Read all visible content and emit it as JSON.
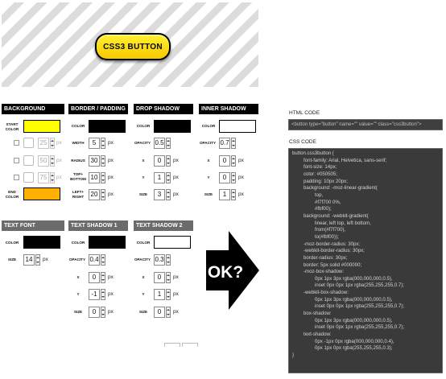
{
  "preview": {
    "button_text": "CSS3 BUTTON"
  },
  "panels": {
    "background": {
      "title": "BACKGROUND",
      "start_color_label": "START COLOR",
      "start_color": "#ffff00",
      "stops": [
        {
          "value": "25"
        },
        {
          "value": "50"
        },
        {
          "value": "75"
        }
      ],
      "end_color_label": "END COLOR",
      "end_color": "#ffb000"
    },
    "border": {
      "title": "BORDER / PADDING",
      "color_label": "COLOR",
      "color": "#000000",
      "width_label": "WIDTH",
      "width": "5",
      "radius_label": "RADIUS",
      "radius": "30",
      "topbottom_label": "TOP+ BOTTOM",
      "topbottom": "10",
      "leftright_label": "LEFT+ RIGHT",
      "leftright": "20"
    },
    "drop_shadow": {
      "title": "DROP SHADOW",
      "color_label": "COLOR",
      "color": "#000000",
      "opacity_label": "OPACITY",
      "opacity": "0.5",
      "x_label": "X",
      "x": "0",
      "y_label": "Y",
      "y": "1",
      "size_label": "SIZE",
      "size": "3"
    },
    "inner_shadow": {
      "title": "INNER SHADOW",
      "color_label": "COLOR",
      "color": "#ffffff",
      "opacity_label": "OPACITY",
      "opacity": "0.7",
      "x_label": "X",
      "x": "0",
      "y_label": "Y",
      "y": "0",
      "size_label": "SIZE",
      "size": "1"
    },
    "text_font": {
      "title": "TEXT FONT",
      "color_label": "COLOR",
      "color": "#000000",
      "size_label": "SIZE",
      "size": "14"
    },
    "text_shadow_1": {
      "title": "TEXT SHADOW 1",
      "color_label": "COLOR",
      "color": "#000000",
      "opacity_label": "OPACITY",
      "opacity": "0.4",
      "x_label": "X",
      "x": "0",
      "y_label": "Y",
      "y": "-1",
      "size_label": "SIZE",
      "size": "0"
    },
    "text_shadow_2": {
      "title": "TEXT SHADOW 2",
      "color_label": "COLOR",
      "color": "#ffffff",
      "opacity_label": "OPACITY",
      "opacity": "0.3",
      "x_label": "X",
      "x": "0",
      "y_label": "Y",
      "y": "1",
      "size_label": "SIZE",
      "size": "0"
    }
  },
  "unit": "px",
  "ok_badge": "OK?",
  "html_code": {
    "label": "HTML CODE",
    "value": "<button type=\"button\" name=\"\" value=\"\" class=\"css3button\">"
  },
  "css_code": {
    "label": "CSS CODE",
    "lines": [
      "button.css3button {",
      "\tfont-family: Arial, Helvetica, sans-serif;",
      "\tfont-size: 14px;",
      "\tcolor: #050505;",
      "\tpadding: 10px 20px;",
      "\tbackground: -moz-linear-gradient(",
      "\t\ttop,",
      "\t\t#f7f700 0%,",
      "\t\t#fbf00);",
      "\tbackground: -webkit-gradient(",
      "\t\tlinear, left top, left bottom,",
      "\t\tfrom(#f7f700),",
      "\t\tto(#fbf00));",
      "\t-moz-border-radius: 30px;",
      "\t-webkit-border-radius: 30px;",
      "\tborder-radius: 30px;",
      "\tborder: 5px solid #000000;",
      "\t-moz-box-shadow:",
      "\t\t0px 1px 3px rgba(000,000,000,0.5),",
      "\t\tinset 0px 0px 1px rgba(255,255,255,0.7);",
      "\t-webkit-box-shadow:",
      "\t\t0px 1px 3px rgba(000,000,000,0.5),",
      "\t\tinset 0px 0px 1px rgba(255,255,255,0.7);",
      "\tbox-shadow:",
      "\t\t0px 1px 3px rgba(000,000,000,0.5),",
      "\t\tinset 0px 0px 1px rgba(255,255,255,0.7);",
      "\ttext-shadow:",
      "\t\t0px -1px 0px rgba(000,000,000,0.4),",
      "\t\t0px 1px 0px rgba(255,255,255,0.3);",
      "}"
    ]
  }
}
